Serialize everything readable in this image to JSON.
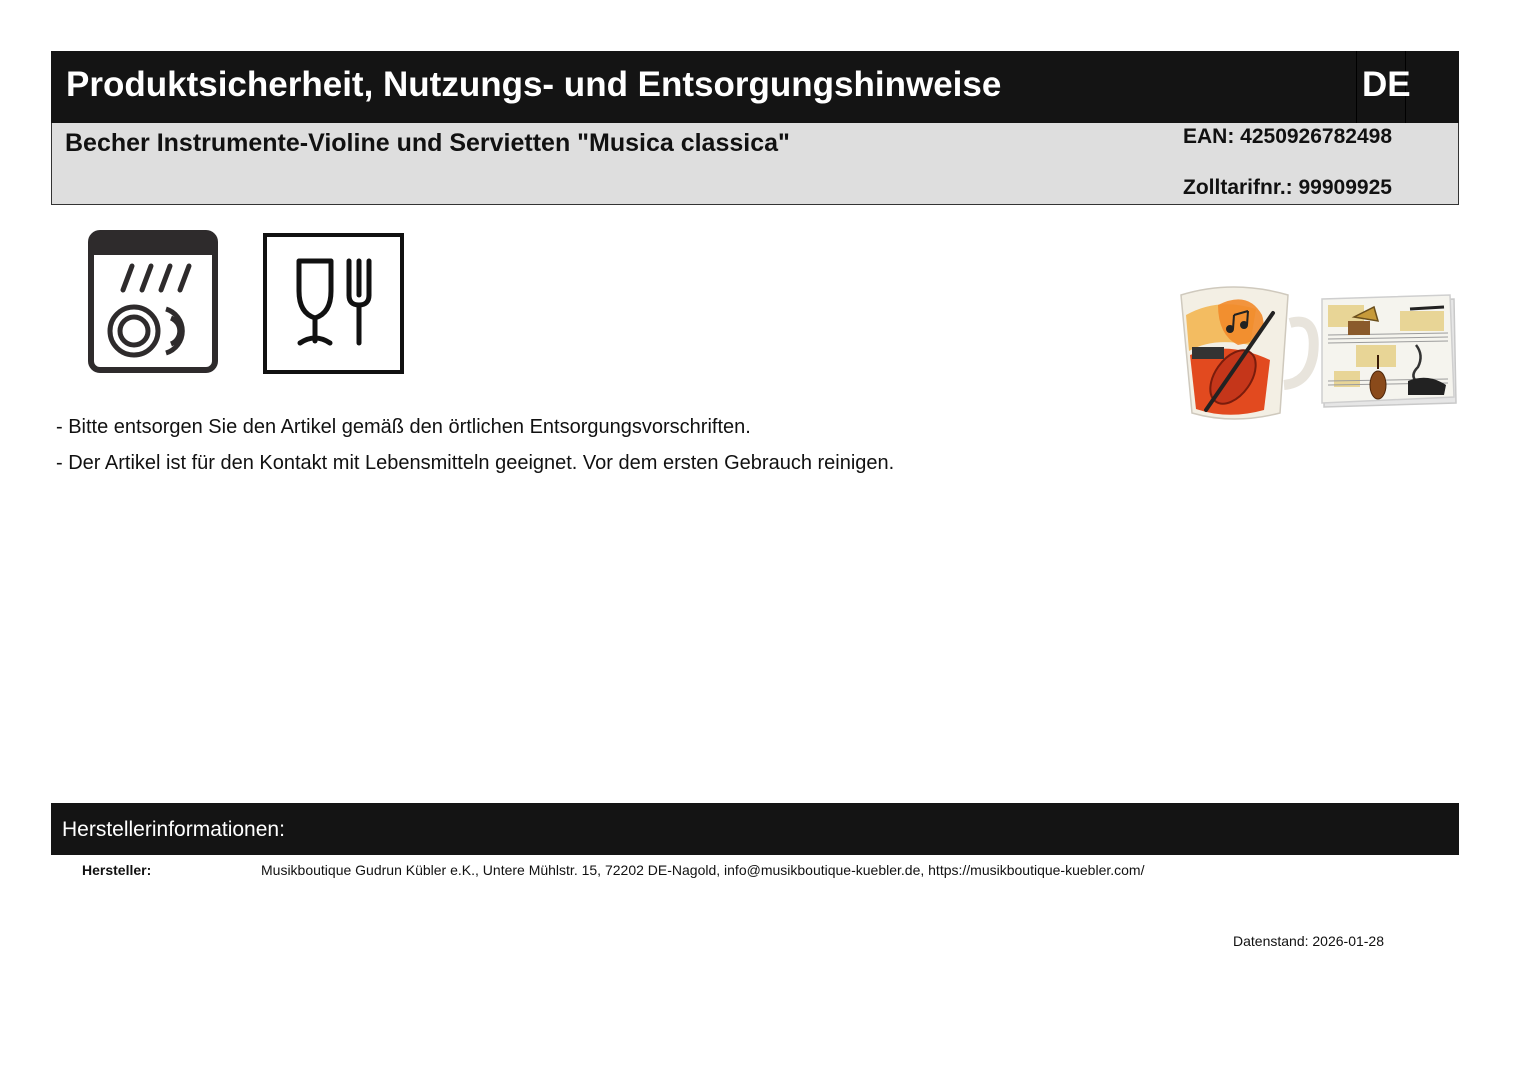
{
  "header": {
    "title": "Produktsicherheit, Nutzungs- und Entsorgungshinweise",
    "language": "DE"
  },
  "product": {
    "name": "Becher Instrumente-Violine und Servietten \"Musica classica\"",
    "ean": "EAN: 4250926782498",
    "customs_no": "Zolltarifnr.: 99909925"
  },
  "symbols": [
    "dishwasher-safe-icon",
    "food-safe-icon"
  ],
  "notes": [
    "- Bitte entsorgen Sie den Artikel gemäß den örtlichen Entsorgungsvorschriften.",
    "- Der Artikel ist für den Kontakt mit Lebensmitteln geeignet. Vor dem ersten Gebrauch reinigen."
  ],
  "manufacturer": {
    "heading": "Herstellerinformationen:",
    "label": "Hersteller:",
    "value": "Musikboutique Gudrun Kübler e.K., Untere Mühlstr. 15, 72202 DE-Nagold, info@musikboutique-kuebler.de, https://musikboutique-kuebler.com/"
  },
  "date": "Datenstand: 2026-01-28",
  "colors": {
    "header_bg": "#141414",
    "product_bar_bg": "#dedede"
  }
}
